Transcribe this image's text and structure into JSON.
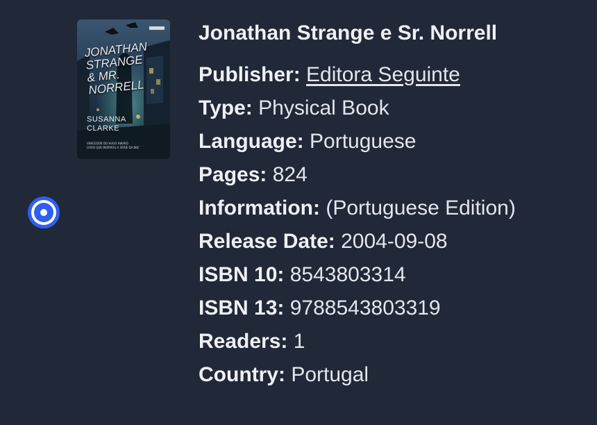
{
  "selection": {
    "state": "selected",
    "icon": "radio-selected-icon"
  },
  "book": {
    "cover": {
      "icon": "book-cover-image",
      "title_text": "Jonathan Strange & Mr. Norrell",
      "author_text": "Susanna Clarke",
      "tagline_text": "Vencedor do Hugo Award. Livro que inspirou a série da BBC"
    },
    "title": "Jonathan Strange e Sr. Norrell",
    "details": [
      {
        "key": "publisher",
        "label": "Publisher:",
        "value": "Editora Seguinte",
        "link": true
      },
      {
        "key": "type",
        "label": "Type:",
        "value": "Physical Book",
        "link": false
      },
      {
        "key": "language",
        "label": "Language:",
        "value": "Portuguese",
        "link": false
      },
      {
        "key": "pages",
        "label": "Pages:",
        "value": "824",
        "link": false
      },
      {
        "key": "information",
        "label": "Information:",
        "value": "(Portuguese Edition)",
        "link": false
      },
      {
        "key": "release-date",
        "label": "Release Date:",
        "value": "2004-09-08",
        "link": false
      },
      {
        "key": "isbn10",
        "label": "ISBN 10:",
        "value": "8543803314",
        "link": false
      },
      {
        "key": "isbn13",
        "label": "ISBN 13:",
        "value": "9788543803319",
        "link": false
      },
      {
        "key": "readers",
        "label": "Readers:",
        "value": "1",
        "link": false
      },
      {
        "key": "country",
        "label": "Country:",
        "value": "Portugal",
        "link": false
      }
    ]
  },
  "colors": {
    "background": "#212838",
    "accent": "#2f5ff0",
    "text": "#e3e6ec"
  }
}
